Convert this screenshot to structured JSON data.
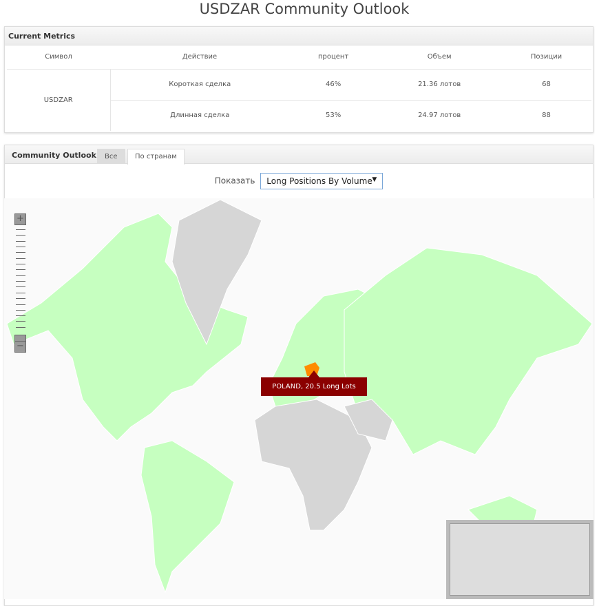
{
  "title": "USDZAR Community Outlook",
  "metrics": {
    "header": "Current Metrics",
    "columns": [
      "Символ",
      "Действие",
      "процент",
      "Объем",
      "Позиции"
    ],
    "symbol": "USDZAR",
    "rows": [
      {
        "action": "Короткая сделка",
        "percent": "46%",
        "volume": "21.36 лотов",
        "positions": "68"
      },
      {
        "action": "Длинная сделка",
        "percent": "53%",
        "volume": "24.97 лотов",
        "positions": "88"
      }
    ]
  },
  "outlook": {
    "header": "Community Outlook",
    "tabs": [
      "Все",
      "По странам"
    ],
    "show_label": "Показать",
    "select_value": "Long Positions By Volume"
  },
  "map": {
    "zoom_in": "+",
    "zoom_out": "−",
    "tooltip": "POLAND, 20.5 Long Lots",
    "colors": {
      "active": "#c6ffc0",
      "inactive": "#d6d6d6",
      "highlight": "#ff8c00",
      "tooltip": "#8b0000"
    }
  }
}
